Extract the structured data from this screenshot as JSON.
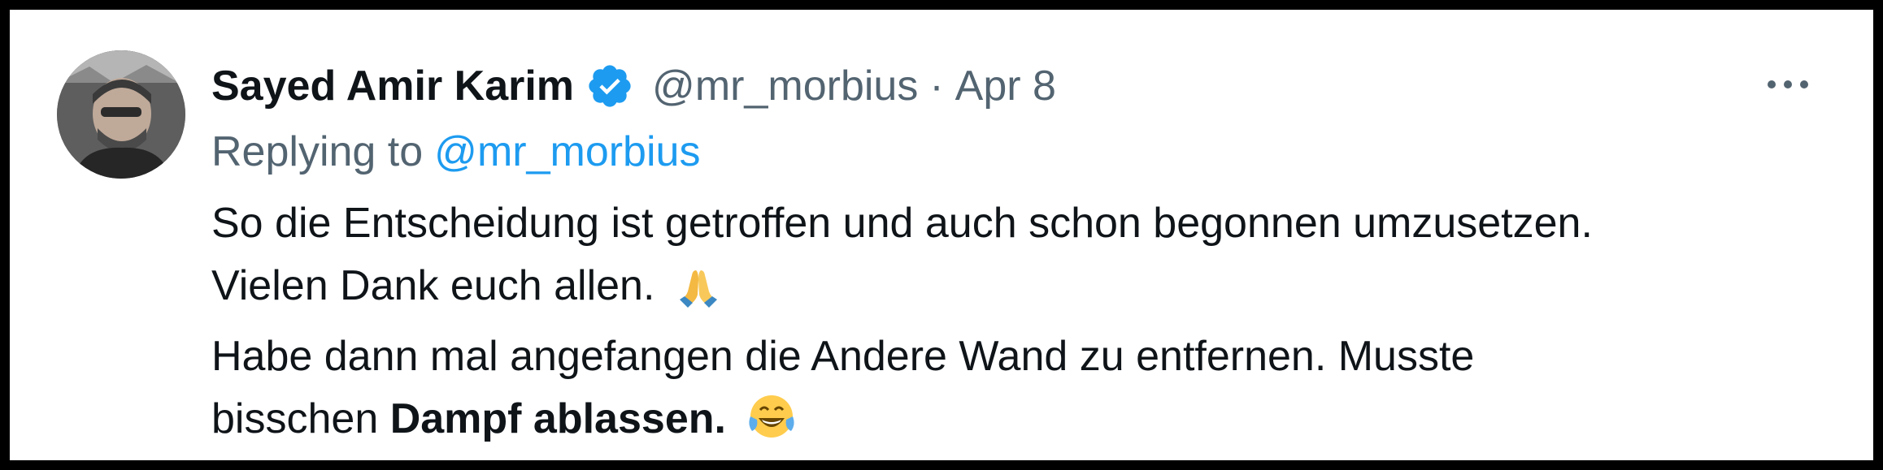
{
  "author": {
    "name": "Sayed Amir Karim",
    "handle": "@mr_morbius",
    "separator": "·",
    "date": "Apr 8",
    "verified_icon": "verified-badge-icon",
    "verified_color": "#1d9bf0"
  },
  "reply": {
    "prefix": "Replying to",
    "handle": "@mr_morbius"
  },
  "tweet": {
    "line1": "So die Entscheidung ist getroffen und auch schon begonnen umzusetzen.",
    "line2": "Vielen Dank euch allen.",
    "line2_emoji": "folded-hands-emoji",
    "line3": "Habe dann mal angefangen die Andere Wand zu entfernen. Musste",
    "line4_plain": "bisschen",
    "line4_bold": "Dampf ablassen.",
    "line4_emoji": "face-with-tears-of-joy-emoji"
  },
  "menu": {
    "icon": "more-options-icon"
  },
  "colors": {
    "text": "#0f1419",
    "muted": "#536471",
    "accent": "#1d9bf0"
  }
}
